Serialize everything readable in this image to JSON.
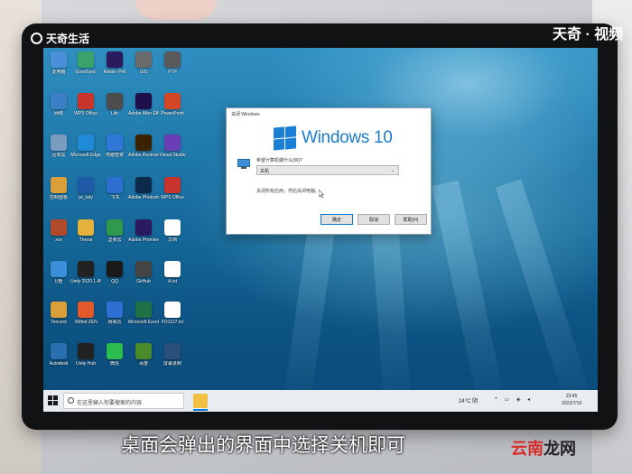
{
  "overlay": {
    "brand_top_left": "天奇生活",
    "brand_top_right": "天奇 · 视频",
    "subtitle": "桌面会弹出的界面中选择关机即可",
    "watermark_red": "云南",
    "watermark_dark": "龙网"
  },
  "desktop": {
    "icons": [
      {
        "label": "此电脑",
        "icon": "pc-icon",
        "color": "#4a90d9"
      },
      {
        "label": "GoodSync",
        "icon": "sync-icon",
        "color": "#3aa36a"
      },
      {
        "label": "Adobe Prel",
        "icon": "premiere-icon",
        "color": "#2a1a5e"
      },
      {
        "label": "GIS",
        "icon": "gis-icon",
        "color": "#6b6b6b"
      },
      {
        "label": "FTP",
        "icon": "ftp-icon",
        "color": "#5a5a5a"
      },
      {
        "label": "网络",
        "icon": "network-icon",
        "color": "#3c7fc5"
      },
      {
        "label": "WPS Office",
        "icon": "wps-icon",
        "color": "#c8342b"
      },
      {
        "label": "Life",
        "icon": "life-icon",
        "color": "#4c4c4c"
      },
      {
        "label": "Adobe After Effects",
        "icon": "ae-icon",
        "color": "#1f0f4a"
      },
      {
        "label": "PowerPoint",
        "icon": "powerpoint-icon",
        "color": "#d24726"
      },
      {
        "label": "回收站",
        "icon": "recycle-bin-icon",
        "color": "#7a9cbf"
      },
      {
        "label": "Microsoft Edge",
        "icon": "edge-icon",
        "color": "#1f8bd6"
      },
      {
        "label": "电脑管家",
        "icon": "shield-icon",
        "color": "#2f78d8"
      },
      {
        "label": "Adobe Illustrator",
        "icon": "illustrator-icon",
        "color": "#3a2100"
      },
      {
        "label": "Visual Studio",
        "icon": "visual-studio-icon",
        "color": "#6a3fb5"
      },
      {
        "label": "控制面板",
        "icon": "control-panel-icon",
        "color": "#d9a03a"
      },
      {
        "label": "pc_kdy",
        "icon": "tools-icon",
        "color": "#1e5aa8"
      },
      {
        "label": "飞书",
        "icon": "feishu-icon",
        "color": "#2c6fd1"
      },
      {
        "label": "Adobe Photoshop",
        "icon": "photoshop-icon",
        "color": "#0c2a4a"
      },
      {
        "label": "WPS Office",
        "icon": "wps-icon",
        "color": "#c8342b"
      },
      {
        "label": "xxx",
        "icon": "game-icon",
        "color": "#b04a2a"
      },
      {
        "label": "Thesis",
        "icon": "folder-icon",
        "color": "#e3b23c"
      },
      {
        "label": "坚果云",
        "icon": "nut-icon",
        "color": "#2f9a4f"
      },
      {
        "label": "Adobe Premiere",
        "icon": "premiere-icon",
        "color": "#2a1a5e"
      },
      {
        "label": "文档",
        "icon": "document-icon",
        "color": "#ffffff"
      },
      {
        "label": "U盘",
        "icon": "drive-icon",
        "color": "#3a8fd8"
      },
      {
        "label": "Unity 2020.1.4f1",
        "icon": "unity-icon",
        "color": "#222222"
      },
      {
        "label": "QQ",
        "icon": "qq-icon",
        "color": "#1a1a1a"
      },
      {
        "label": "GitHub",
        "icon": "github-icon",
        "color": "#444444"
      },
      {
        "label": "A.txt",
        "icon": "text-file-icon",
        "color": "#ffffff"
      },
      {
        "label": "Tencent",
        "icon": "tencent-icon",
        "color": "#d9a03a"
      },
      {
        "label": "XMind ZEN",
        "icon": "xmind-icon",
        "color": "#e05a2b"
      },
      {
        "label": "网易云",
        "icon": "arrow-icon",
        "color": "#2e6fd4"
      },
      {
        "label": "Microsoft Excel",
        "icon": "excel-icon",
        "color": "#1e7145"
      },
      {
        "label": "FD1127.txt",
        "icon": "text-file-icon",
        "color": "#ffffff"
      },
      {
        "label": "Autodesk",
        "icon": "autodesk-icon",
        "color": "#2a6fb0"
      },
      {
        "label": "Unity Hub",
        "icon": "unity-icon",
        "color": "#222222"
      },
      {
        "label": "微信",
        "icon": "wechat-icon",
        "color": "#2dbd4e"
      },
      {
        "label": "百度",
        "icon": "baidu-icon",
        "color": "#4a8a2a"
      },
      {
        "label": "屏幕录制",
        "icon": "screen-icon",
        "color": "#2a4f7a"
      }
    ]
  },
  "dialog": {
    "title": "关闭 Windows",
    "product": "Windows 10",
    "question": "希望计算机做什么(W)?",
    "selected_option": "关机",
    "description": "关闭所有应用，然后关闭电脑。",
    "ok_label": "确定",
    "cancel_label": "取消",
    "help_label": "帮助(H)"
  },
  "taskbar": {
    "search_placeholder": "在这里输入你要搜索的内容",
    "weather": "24°C 阴",
    "time": "23:45",
    "date": "2022/7/10"
  },
  "colors": {
    "accent": "#0078d7",
    "windows_blue": "#1f7ccc"
  }
}
